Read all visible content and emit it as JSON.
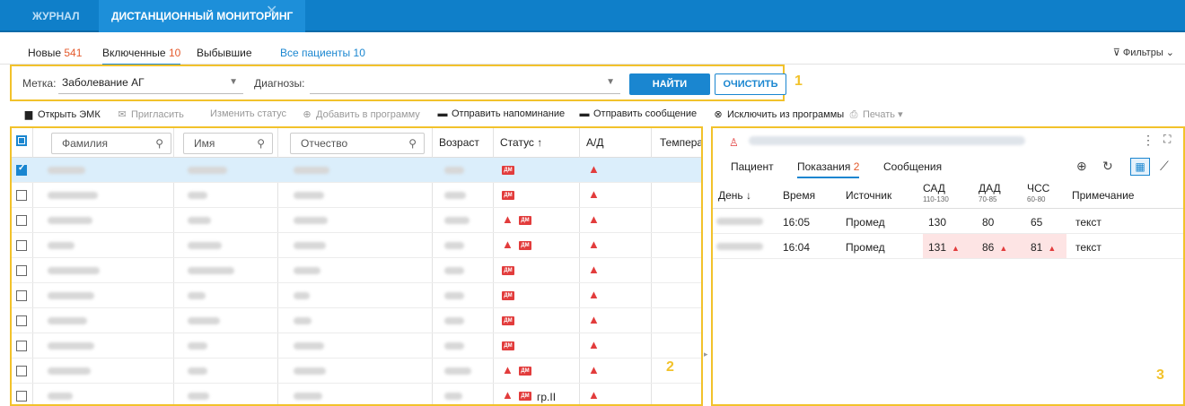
{
  "top_tabs": {
    "journal": "ЖУРНАЛ",
    "monitoring": "ДИСТАНЦИОННЫЙ МОНИТОРИНГ",
    "close": "✕"
  },
  "subtabs": {
    "new_label": "Новые",
    "new_count": "541",
    "included_label": "Включенные",
    "included_count": "10",
    "dropped_label": "Выбывшие",
    "all_label": "Все пациенты",
    "all_count": "10",
    "filters": "Фильтры"
  },
  "filterbar": {
    "tag_label": "Метка:",
    "tag_value": "Заболевание АГ",
    "diag_label": "Диагнозы:",
    "diag_value": "",
    "find": "НАЙТИ",
    "clear": "ОЧИСТИТЬ",
    "marker": "1"
  },
  "toolbar": {
    "open_emk": "Открыть ЭМК",
    "invite": "Пригласить",
    "change_status": "Изменить статус",
    "add_program": "Добавить в программу",
    "send_reminder": "Отправить напоминание",
    "send_message": "Отправить сообщение",
    "exclude": "Исключить из программы",
    "print": "Печать"
  },
  "patients_table": {
    "search_lastname": "Фамилия",
    "search_firstname": "Имя",
    "search_patronymic": "Отчество",
    "col_age": "Возраст",
    "col_status": "Статус",
    "col_bp": "А/Д",
    "col_temp": "Температ",
    "dm_badge": "ДМ",
    "group_text": "гр.II",
    "marker": "2"
  },
  "patient_panel": {
    "tab_patient": "Пациент",
    "tab_readings": "Показания",
    "readings_count": "2",
    "tab_messages": "Сообщения",
    "col_day": "День",
    "col_time": "Время",
    "col_source": "Источник",
    "col_sad": "САД",
    "sad_range": "110-130",
    "col_dad": "ДАД",
    "dad_range": "70-85",
    "col_hr": "ЧСС",
    "hr_range": "60-80",
    "col_note": "Примечание",
    "rows": [
      {
        "time": "16:05",
        "source": "Промед",
        "sad": "130",
        "dad": "80",
        "hr": "65",
        "note": "текст"
      },
      {
        "time": "16:04",
        "source": "Промед",
        "sad": "131",
        "dad": "86",
        "hr": "81",
        "note": "текст"
      }
    ],
    "marker": "3"
  },
  "colors": {
    "accent": "#1a86d0",
    "header": "#0f7fc9",
    "highlight": "#f2c22b",
    "alert": "#e23c3c"
  }
}
